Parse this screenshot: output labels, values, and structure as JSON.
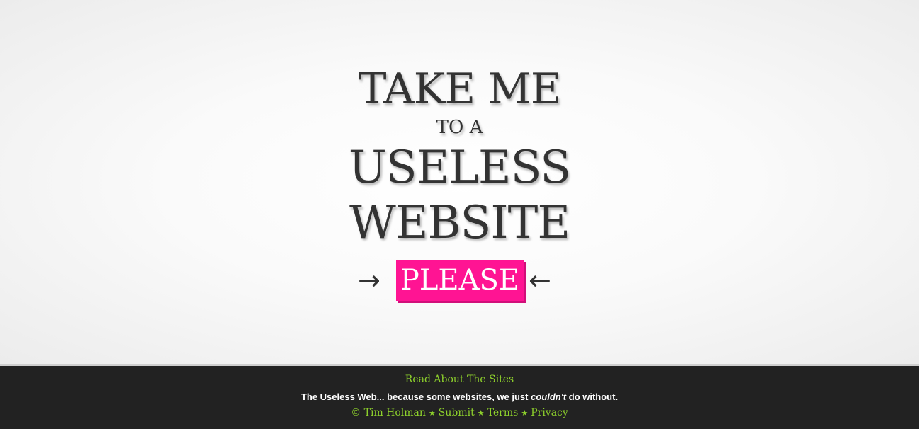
{
  "headline": {
    "line1": "TAKE ME",
    "line2": "TO A",
    "line3": "USELESS",
    "line4": "WEBSITE"
  },
  "please_button": {
    "label": "PLEASE",
    "arrow_left": "→",
    "arrow_right": "←"
  },
  "footer": {
    "read_about": "Read About The Sites",
    "tagline_pre": "The Useless Web... because some websites, we just ",
    "tagline_em": "couldn't",
    "tagline_post": " do without.",
    "copyright": "© Tim Holman",
    "submit": "Submit",
    "terms": "Terms",
    "privacy": "Privacy",
    "separator": "★"
  },
  "colors": {
    "button": "#ff1493",
    "link": "#8ed12c",
    "footer_bg": "#222222",
    "headline": "#333333"
  }
}
